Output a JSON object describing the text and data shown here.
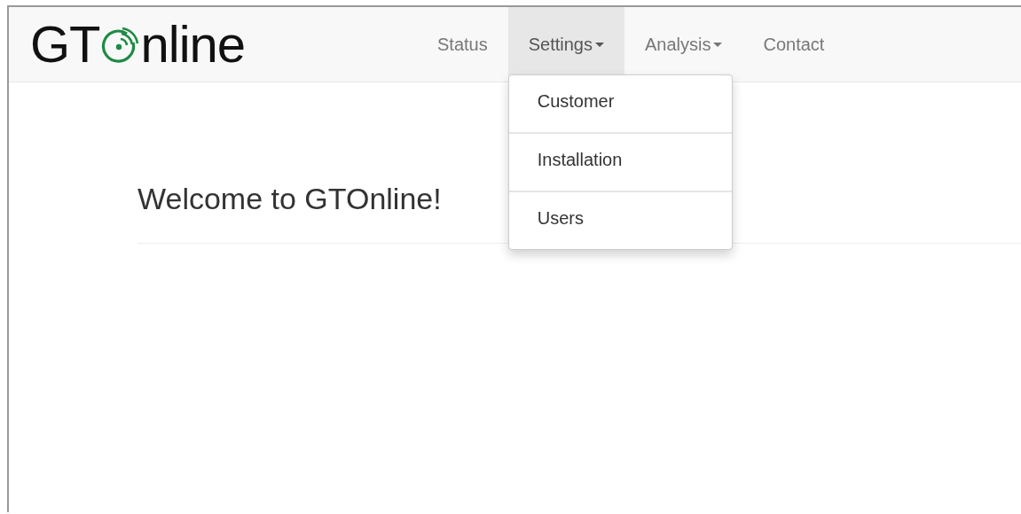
{
  "logo": {
    "before": "GT",
    "after": "nline"
  },
  "nav": [
    {
      "label": "Status",
      "kind": "link",
      "open": false
    },
    {
      "label": "Settings",
      "kind": "dropdown",
      "open": true,
      "menu": [
        "Customer",
        "Installation",
        "Users"
      ]
    },
    {
      "label": "Analysis",
      "kind": "dropdown",
      "open": false
    },
    {
      "label": "Contact",
      "kind": "link",
      "open": false
    }
  ],
  "heading": "Welcome to GTOnline!"
}
